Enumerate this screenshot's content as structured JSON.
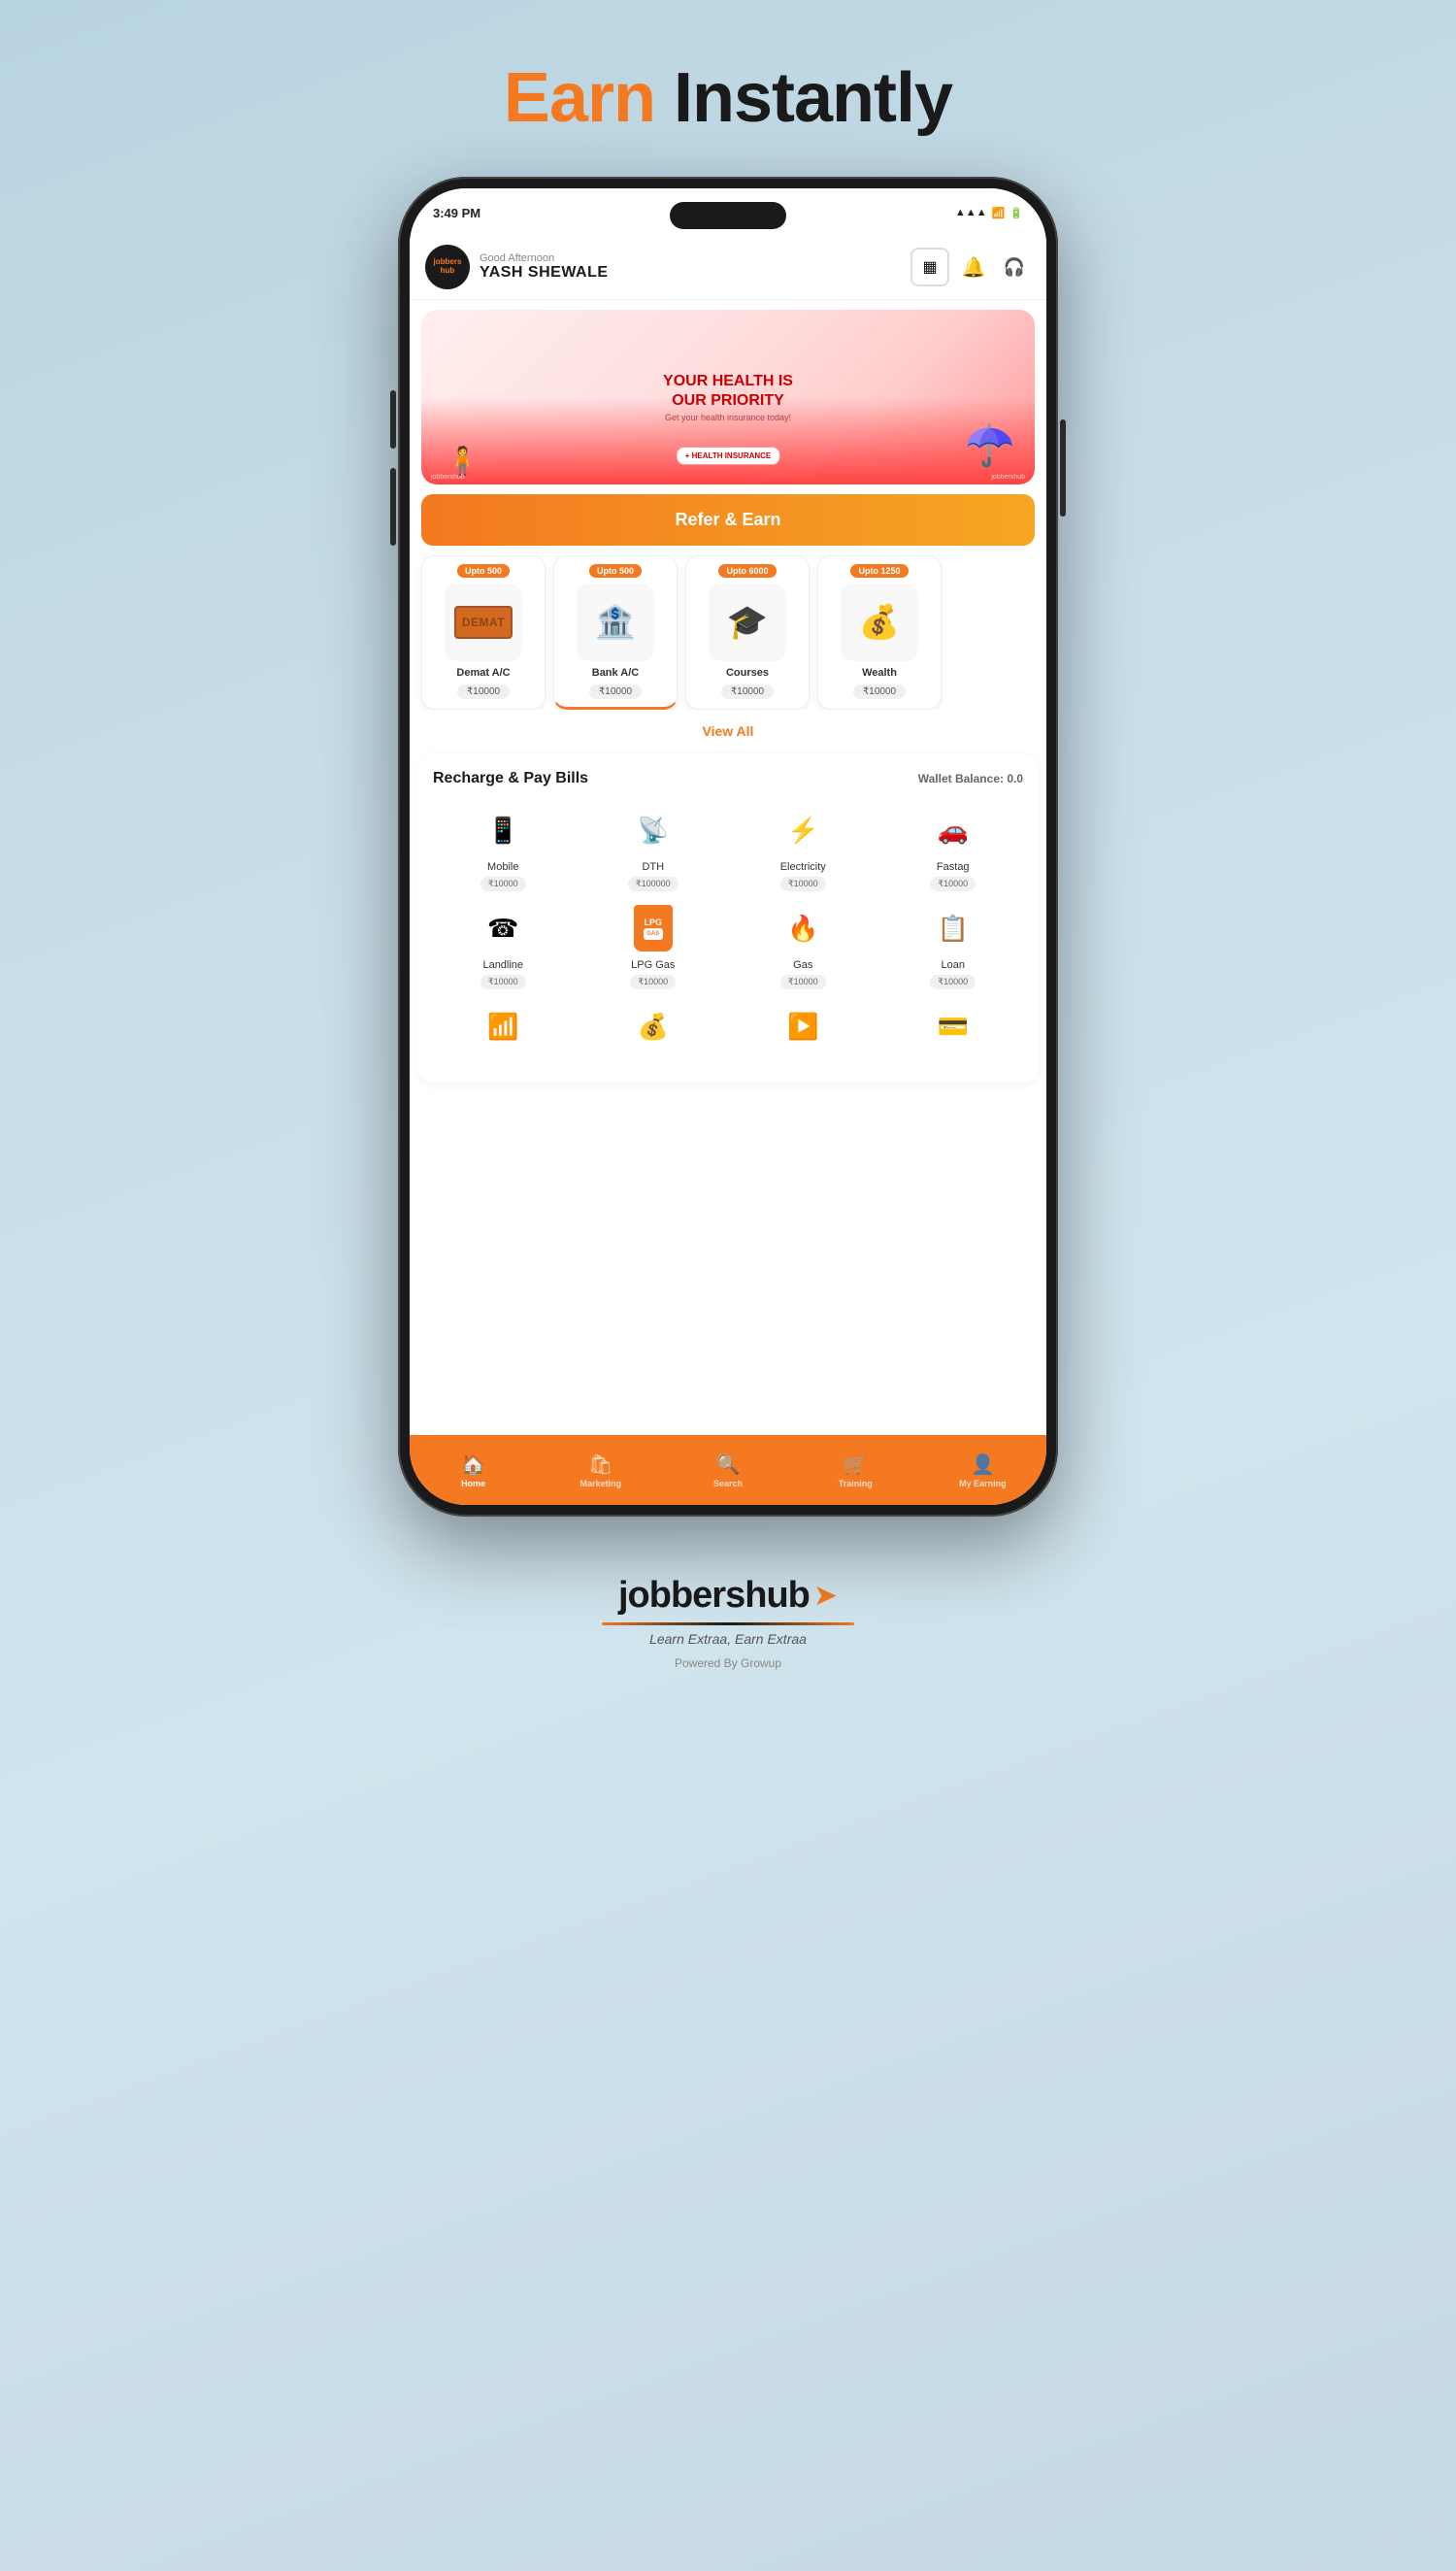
{
  "page": {
    "title_earn": "Earn",
    "title_rest": " Instantly"
  },
  "status_bar": {
    "time": "3:49 PM",
    "icons": "▲▲▲"
  },
  "header": {
    "greeting": "Good Afternoon",
    "user_name": "YASH SHEWALE",
    "logo_text": "jobbershub"
  },
  "banner": {
    "title": "YOUR HEALTH IS\nOUR PRIORITY",
    "subtitle": "Get your health insurance today!"
  },
  "refer_btn": "Refer & Earn",
  "services": [
    {
      "badge": "Upto 500",
      "label": "Demat A/C",
      "amount": "₹10000",
      "icon": "📦"
    },
    {
      "badge": "Upto 500",
      "label": "Bank A/C",
      "amount": "₹10000",
      "icon": "🏦"
    },
    {
      "badge": "Upto 6000",
      "label": "Courses",
      "amount": "₹10000",
      "icon": "🎓"
    },
    {
      "badge": "Upto 1250",
      "label": "Wealth",
      "amount": "₹10000",
      "icon": "💰"
    }
  ],
  "view_all": "View All",
  "bills_section": {
    "title": "Recharge & Pay Bills",
    "wallet_label": "Wallet Balance: 0.0"
  },
  "bills": [
    {
      "label": "Mobile",
      "amount": "₹10000",
      "icon": "📱"
    },
    {
      "label": "DTH",
      "amount": "₹100000",
      "icon": "📡"
    },
    {
      "label": "Electricity",
      "amount": "₹10000",
      "icon": "⚡"
    },
    {
      "label": "Fastag",
      "amount": "₹10000",
      "icon": "🚗"
    },
    {
      "label": "Landline",
      "amount": "₹10000",
      "icon": "☎"
    },
    {
      "label": "LPG Gas",
      "amount": "₹10000",
      "icon": "🧴"
    },
    {
      "label": "Gas",
      "amount": "₹10000",
      "icon": "🔥"
    },
    {
      "label": "Loan",
      "amount": "₹10000",
      "icon": "📋"
    }
  ],
  "nav": [
    {
      "label": "Home",
      "icon": "🏠",
      "active": true
    },
    {
      "label": "Marketing",
      "icon": "🛍",
      "active": false
    },
    {
      "label": "Search",
      "icon": "🔍",
      "active": false
    },
    {
      "label": "Training",
      "icon": "🛒",
      "active": false
    },
    {
      "label": "My Earning",
      "icon": "👤",
      "active": false
    }
  ],
  "footer": {
    "logo_text": "jobbershub",
    "tagline": "Learn Extraa, Earn Extraa",
    "powered": "Powered By Growup"
  }
}
